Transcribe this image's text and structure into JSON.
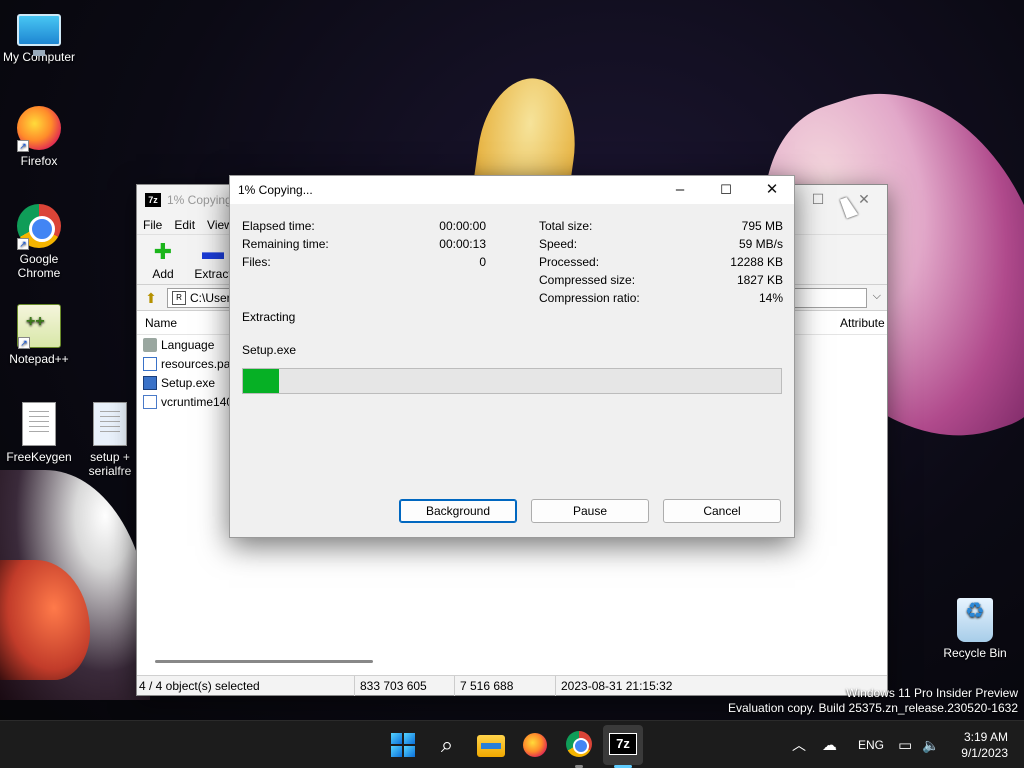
{
  "desktop": {
    "icons": [
      {
        "label": "My Computer"
      },
      {
        "label": "Firefox"
      },
      {
        "label": "Google Chrome"
      },
      {
        "label": "Notepad++"
      },
      {
        "label": "FreeKeygen"
      },
      {
        "label": "setup + serialfre"
      },
      {
        "label": "Recycle Bin"
      }
    ]
  },
  "zip_window": {
    "title": "1% Copying...",
    "menu": [
      "File",
      "Edit",
      "View"
    ],
    "toolbar": {
      "add_label": "Add",
      "extract_label": "Extract"
    },
    "address": "C:\\Users",
    "columns": {
      "name": "Name",
      "attributes": "Attribute"
    },
    "files": [
      {
        "name": "Language",
        "type": "folder"
      },
      {
        "name": "resources.pak",
        "type": "file"
      },
      {
        "name": "Setup.exe",
        "type": "exe"
      },
      {
        "name": "vcruntime140",
        "type": "dll"
      }
    ],
    "status": {
      "selected": "4 / 4 object(s) selected",
      "size": "833 703 605",
      "packed": "7 516 688",
      "modified": "2023-08-31 21:15:32"
    }
  },
  "dialog": {
    "title": "1% Copying...",
    "left_stats": [
      {
        "label": "Elapsed time:",
        "value": "00:00:00"
      },
      {
        "label": "Remaining time:",
        "value": "00:00:13"
      },
      {
        "label": "Files:",
        "value": "0"
      }
    ],
    "right_stats": [
      {
        "label": "Total size:",
        "value": "795 MB"
      },
      {
        "label": "Speed:",
        "value": "59 MB/s"
      },
      {
        "label": "Processed:",
        "value": "12288 KB"
      },
      {
        "label": "Compressed size:",
        "value": "1827 KB"
      },
      {
        "label": "Compression ratio:",
        "value": "14%"
      }
    ],
    "operation": "Extracting",
    "current_file": "Setup.exe",
    "progress_percent": 6.7,
    "progress_color": "#06b025",
    "buttons": {
      "background": "Background",
      "pause": "Pause",
      "cancel": "Cancel"
    }
  },
  "watermark": {
    "line1": "Windows 11 Pro Insider Preview",
    "line2": "Evaluation copy. Build 25375.zn_release.230520-1632"
  },
  "taskbar": {
    "tray_language": "ENG",
    "time": "3:19 AM",
    "date": "9/1/2023"
  }
}
